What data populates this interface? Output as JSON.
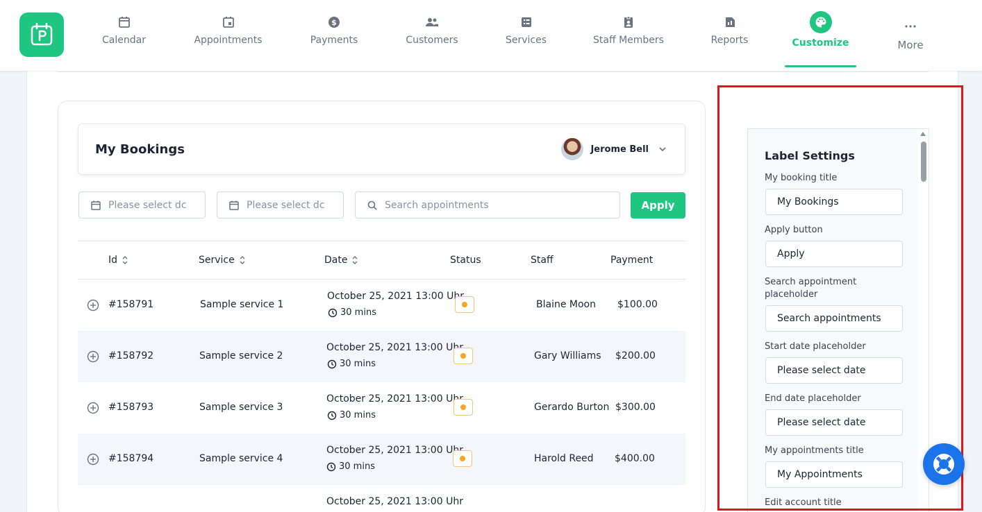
{
  "nav": {
    "items": [
      {
        "label": "Calendar",
        "icon": "calendar-icon"
      },
      {
        "label": "Appointments",
        "icon": "calendar-check-icon"
      },
      {
        "label": "Payments",
        "icon": "dollar-icon"
      },
      {
        "label": "Customers",
        "icon": "users-icon"
      },
      {
        "label": "Services",
        "icon": "list-icon"
      },
      {
        "label": "Staff Members",
        "icon": "badge-icon"
      },
      {
        "label": "Reports",
        "icon": "report-icon"
      },
      {
        "label": "Customize",
        "icon": "palette-icon",
        "active": true
      },
      {
        "label": "More",
        "icon": "more-icon"
      }
    ],
    "accent": "#1fc681"
  },
  "preview": {
    "title": "My Bookings",
    "user_name": "Jerome Bell",
    "start_date_placeholder": "Please select dc",
    "end_date_placeholder": "Please select dc",
    "search_placeholder": "Search appointments",
    "apply_label": "Apply",
    "columns": [
      "Id",
      "Service",
      "Date",
      "Status",
      "Staff",
      "Payment"
    ],
    "rows": [
      {
        "id": "#158791",
        "service": "Sample service 1",
        "date": "October 25, 2021 13:00 Uhr",
        "duration": "30 mins",
        "staff": "Blaine Moon",
        "payment": "$100.00"
      },
      {
        "id": "#158792",
        "service": "Sample service 2",
        "date": "October 25, 2021 13:00 Uhr",
        "duration": "30 mins",
        "staff": "Gary Williams",
        "payment": "$200.00"
      },
      {
        "id": "#158793",
        "service": "Sample service 3",
        "date": "October 25, 2021 13:00 Uhr",
        "duration": "30 mins",
        "staff": "Gerardo Burton",
        "payment": "$300.00"
      },
      {
        "id": "#158794",
        "service": "Sample service 4",
        "date": "October 25, 2021 13:00 Uhr",
        "duration": "30 mins",
        "staff": "Harold Reed",
        "payment": "$400.00"
      },
      {
        "id": "",
        "service": "",
        "date": "October 25, 2021 13:00 Uhr",
        "duration": "",
        "staff": "",
        "payment": ""
      }
    ],
    "status_color": "#f5a623"
  },
  "settings": {
    "title": "Label Settings",
    "fields": [
      {
        "label": "My booking title",
        "value": "My Bookings"
      },
      {
        "label": "Apply button",
        "value": "Apply"
      },
      {
        "label": "Search appointment placeholder",
        "value": "Search appointments"
      },
      {
        "label": "Start date placeholder",
        "value": "Please select date"
      },
      {
        "label": "End date placeholder",
        "value": "Please select date"
      },
      {
        "label": "My appointments title",
        "value": "My Appointments"
      },
      {
        "label": "Edit account title",
        "value": ""
      }
    ],
    "highlight_color": "#e0161b"
  }
}
